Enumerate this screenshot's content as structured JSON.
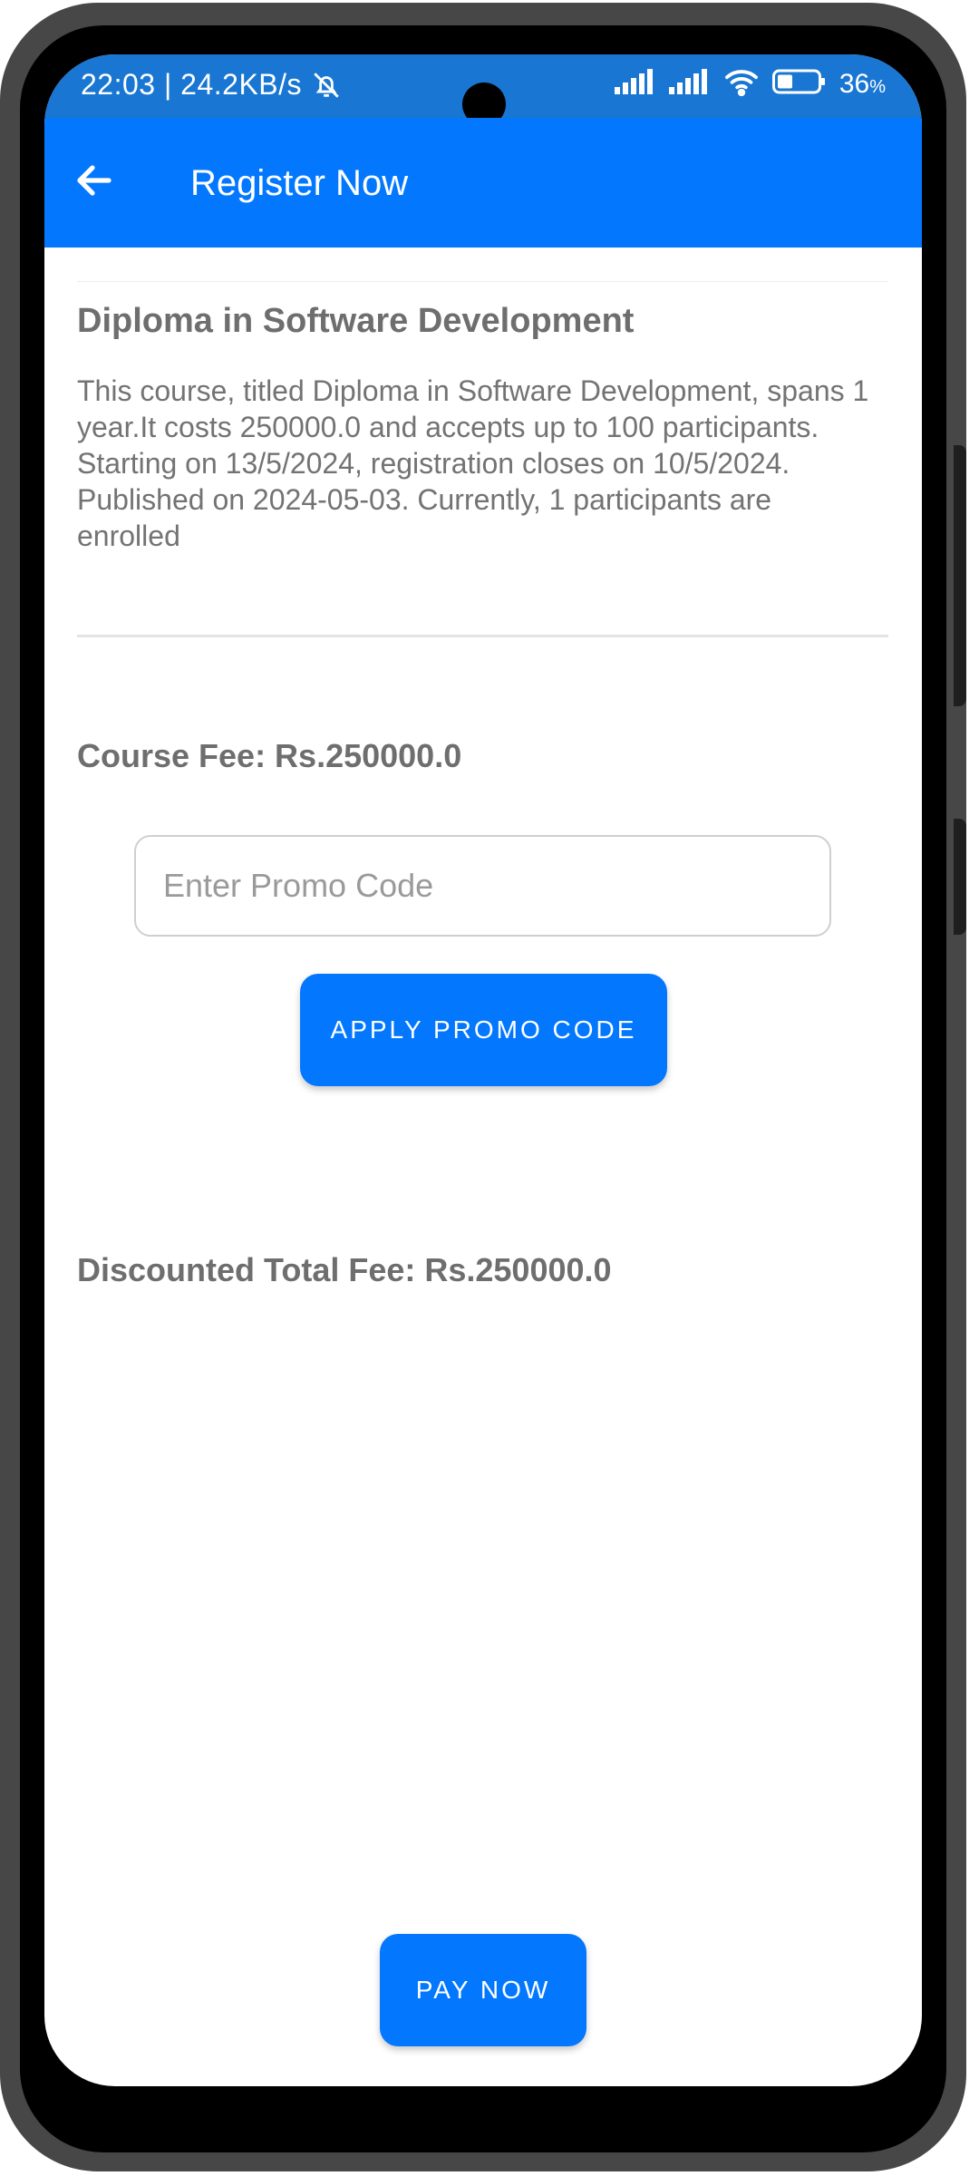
{
  "status_bar": {
    "time_and_speed": "22:03 | 24.2KB/s",
    "battery_level": "36",
    "battery_unit": "%",
    "icons": [
      "mute-bell-icon",
      "signal-icon",
      "signal-icon",
      "wifi-icon",
      "battery-icon"
    ]
  },
  "app_bar": {
    "title": "Register Now",
    "back_icon": "arrow-left-icon"
  },
  "course": {
    "title": "Diploma in Software Development",
    "description": "This course, titled Diploma in Software Development, spans 1 year.It costs 250000.0 and accepts up to 100 participants. Starting on 13/5/2024, registration closes on 10/5/2024. Published on 2024-05-03. Currently, 1 participants are enrolled"
  },
  "fees": {
    "course_fee_label": "Course Fee: Rs.250000.0",
    "discounted_total_label": "Discounted Total Fee: Rs.250000.0"
  },
  "promo": {
    "placeholder": "Enter Promo Code",
    "value": "",
    "apply_label": "APPLY PROMO CODE"
  },
  "actions": {
    "pay_label": "PAY NOW"
  },
  "colors": {
    "app_bar": "#0378fe",
    "status_bar": "#1976d2",
    "button": "#0378fe",
    "text_muted": "#6e6e6e"
  }
}
